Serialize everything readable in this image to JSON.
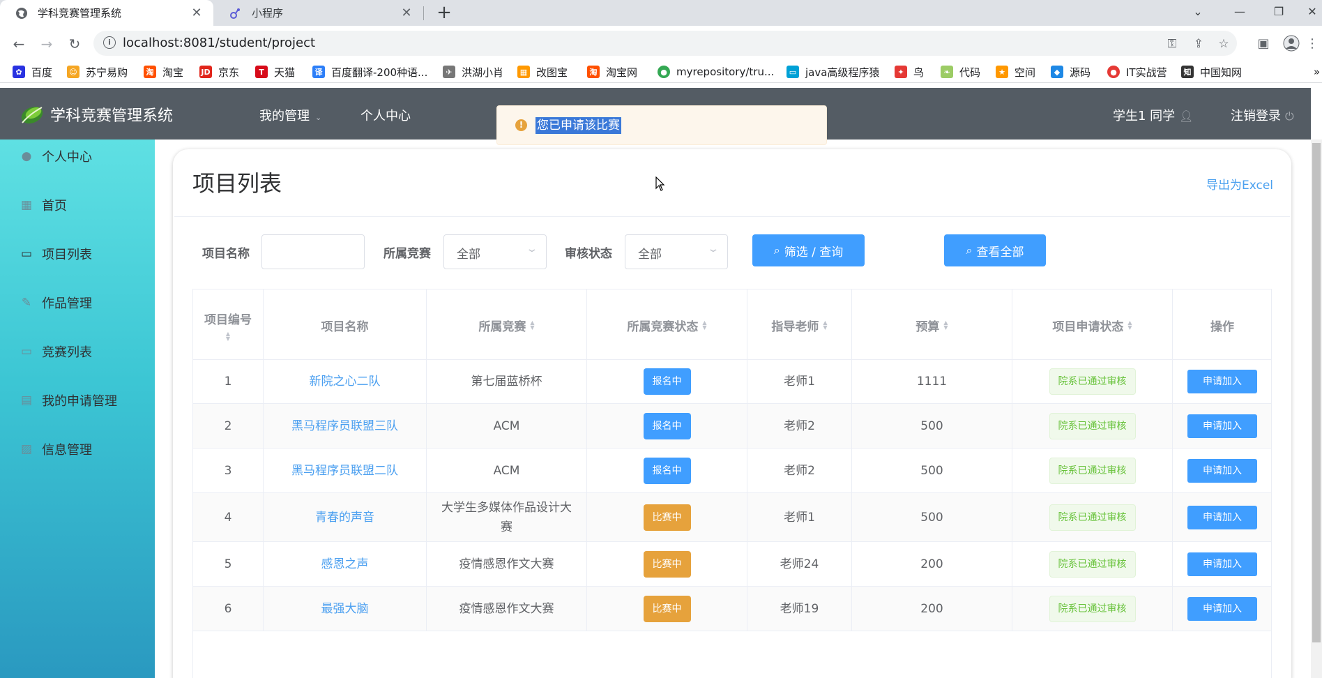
{
  "browser": {
    "tabs": [
      {
        "title": "学科竞赛管理系统",
        "icon": "globe-icon",
        "active": true
      },
      {
        "title": "小程序",
        "icon": "link-icon",
        "active": false
      }
    ],
    "url": "localhost:8081/student/project",
    "bookmarks": [
      {
        "label": "百度",
        "color": "#2932e1"
      },
      {
        "label": "苏宁易购",
        "color": "#f5a623"
      },
      {
        "label": "淘宝",
        "color": "#ff5000"
      },
      {
        "label": "京东",
        "color": "#e1251b"
      },
      {
        "label": "天猫",
        "color": "#d70b1a"
      },
      {
        "label": "百度翻译-200种语...",
        "color": "#2c7ef8"
      },
      {
        "label": "洪湖小肖",
        "color": "#777777"
      },
      {
        "label": "改图宝",
        "color": "#ff9900"
      },
      {
        "label": "淘宝网",
        "color": "#ff5000"
      },
      {
        "label": "myrepository/tru...",
        "color": "#34a853"
      },
      {
        "label": "java高级程序猿",
        "color": "#00a1d6"
      },
      {
        "label": "鸟",
        "color": "#e53935"
      },
      {
        "label": "代码",
        "color": "#9ccc65"
      },
      {
        "label": "空间",
        "color": "#ff9800"
      },
      {
        "label": "源码",
        "color": "#1e88e5"
      },
      {
        "label": "IT实战营",
        "color": "#e53935"
      },
      {
        "label": "中国知网",
        "color": "#333333"
      }
    ]
  },
  "header": {
    "app_title": "学科竞赛管理系统",
    "nav": [
      {
        "label": "我的管理",
        "has_caret": true
      },
      {
        "label": "个人中心",
        "has_caret": false
      }
    ],
    "user_label": "学生1 同学",
    "logout_label": "注销登录"
  },
  "toast": {
    "text": "您已申请该比赛",
    "type": "warning"
  },
  "sidebar": {
    "items": [
      {
        "label": "个人中心",
        "icon": "user-icon"
      },
      {
        "label": "首页",
        "icon": "grid-icon"
      },
      {
        "label": "项目列表",
        "icon": "list-icon"
      },
      {
        "label": "作品管理",
        "icon": "edit-icon"
      },
      {
        "label": "竞赛列表",
        "icon": "folder-icon"
      },
      {
        "label": "我的申请管理",
        "icon": "card-icon"
      },
      {
        "label": "信息管理",
        "icon": "chart-icon"
      }
    ]
  },
  "page": {
    "title": "项目列表",
    "export_label": "导出为Excel"
  },
  "filters": {
    "name_label": "项目名称",
    "name_value": "",
    "competition_label": "所属竞赛",
    "competition_value": "全部",
    "status_label": "审核状态",
    "status_value": "全部",
    "search_button": "筛选 / 查询",
    "all_button": "查看全部"
  },
  "table": {
    "columns": [
      "项目编号",
      "项目名称",
      "所属竞赛",
      "所属竞赛状态",
      "指导老师",
      "预算",
      "项目申请状态",
      "操作"
    ],
    "rows": [
      {
        "id": "1",
        "name": "新院之心二队",
        "competition": "第七届蓝桥杯",
        "comp_status": "报名中",
        "comp_status_color": "#409eff",
        "teacher": "老师1",
        "budget": "1111",
        "apply_status": "院系已通过审核",
        "action": "申请加入"
      },
      {
        "id": "2",
        "name": "黑马程序员联盟三队",
        "competition": "ACM",
        "comp_status": "报名中",
        "comp_status_color": "#409eff",
        "teacher": "老师2",
        "budget": "500",
        "apply_status": "院系已通过审核",
        "action": "申请加入"
      },
      {
        "id": "3",
        "name": "黑马程序员联盟二队",
        "competition": "ACM",
        "comp_status": "报名中",
        "comp_status_color": "#409eff",
        "teacher": "老师2",
        "budget": "500",
        "apply_status": "院系已通过审核",
        "action": "申请加入"
      },
      {
        "id": "4",
        "name": "青春的声音",
        "competition": "大学生多媒体作品设计大赛",
        "comp_status": "比赛中",
        "comp_status_color": "#e6a23c",
        "teacher": "老师1",
        "budget": "500",
        "apply_status": "院系已通过审核",
        "action": "申请加入"
      },
      {
        "id": "5",
        "name": "感恩之声",
        "competition": "疫情感恩作文大赛",
        "comp_status": "比赛中",
        "comp_status_color": "#e6a23c",
        "teacher": "老师24",
        "budget": "200",
        "apply_status": "院系已通过审核",
        "action": "申请加入"
      },
      {
        "id": "6",
        "name": "最强大脑",
        "competition": "疫情感恩作文大赛",
        "comp_status": "比赛中",
        "comp_status_color": "#e6a23c",
        "teacher": "老师19",
        "budget": "200",
        "apply_status": "院系已通过审核",
        "action": "申请加入"
      }
    ]
  }
}
